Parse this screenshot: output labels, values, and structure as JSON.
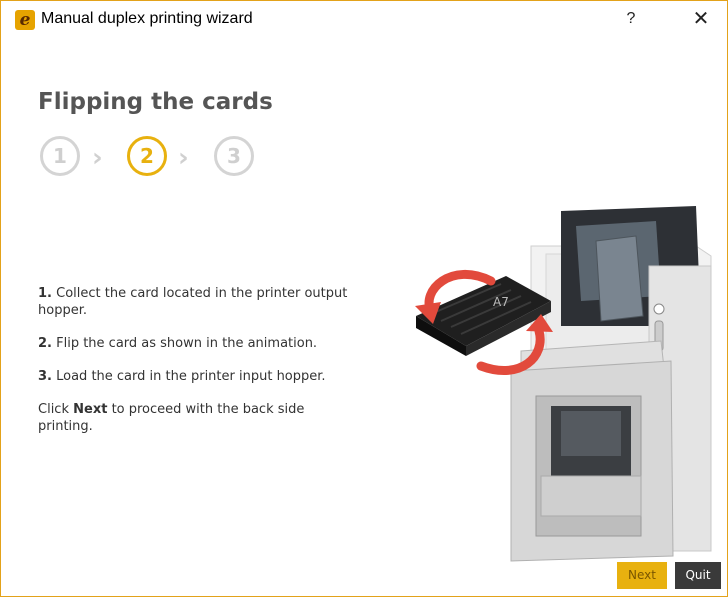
{
  "window": {
    "title": "Manual duplex printing wizard",
    "icon_letter": "e",
    "help_label": "?",
    "close_label": "✕"
  },
  "page": {
    "heading": "Flipping the cards"
  },
  "stepper": {
    "steps": [
      "1",
      "2",
      "3"
    ],
    "active_step": "2",
    "separator": "›"
  },
  "instructions": {
    "step1_num": "1.",
    "step1_text": "Collect the card located in the printer output hopper.",
    "step2_num": "2.",
    "step2_text": "Flip the card as shown in the animation.",
    "step3_num": "3.",
    "step3_text": "Load the card in the printer input hopper.",
    "click_prefix": "Click",
    "click_bold": "Next",
    "click_suffix": "to proceed with the back side printing."
  },
  "buttons": {
    "next_label": "Next",
    "quit_label": "Quit"
  },
  "colors": {
    "accent": "#e8b10f",
    "window_border": "#e3a21a",
    "quit_bg": "#3a3a3a",
    "arrow": "#e24a3c"
  }
}
